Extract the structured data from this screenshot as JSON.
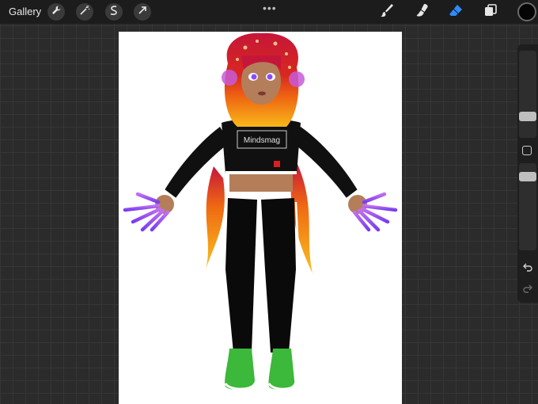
{
  "toolbar": {
    "gallery_label": "Gallery",
    "left_tools": [
      {
        "icon": "wrench-icon"
      },
      {
        "icon": "magic-wand-icon"
      },
      {
        "icon": "selection-icon"
      },
      {
        "icon": "transform-arrow-icon"
      }
    ],
    "more_label": "•••",
    "right_tools": [
      {
        "icon": "brush-icon"
      },
      {
        "icon": "smudge-icon"
      },
      {
        "icon": "eraser-icon",
        "active_color": "#2f8bff"
      },
      {
        "icon": "layers-icon"
      }
    ],
    "current_color": "#050505"
  },
  "canvas": {
    "shirt_text": "Mindsmag"
  },
  "sidebar": {
    "brush_size_level": 0.3,
    "opacity_level": 0.85
  }
}
